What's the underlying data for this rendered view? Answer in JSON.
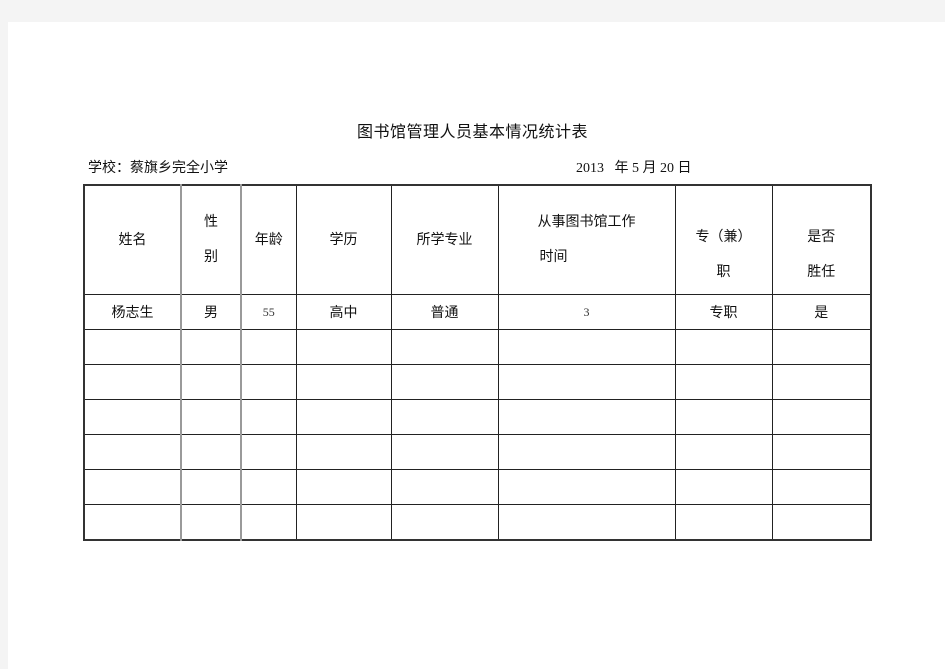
{
  "document": {
    "title": "图书馆管理人员基本情况统计表",
    "school_label": "学校：蔡旗乡完全小学",
    "date": {
      "year": "2013",
      "year_unit": "年",
      "month": "5",
      "month_unit": "月",
      "day": "20",
      "day_unit": "日"
    }
  },
  "table": {
    "headers": [
      {
        "lines": [
          "姓名"
        ]
      },
      {
        "lines": [
          "性",
          "别"
        ]
      },
      {
        "lines": [
          "年龄"
        ]
      },
      {
        "lines": [
          "学历"
        ]
      },
      {
        "lines": [
          "所学专业"
        ]
      },
      {
        "lines": [
          "从事图书馆工作",
          "时间"
        ]
      },
      {
        "lines": [
          "专（兼）",
          "职"
        ]
      },
      {
        "lines": [
          "是否",
          "胜任"
        ]
      }
    ],
    "rows": [
      [
        "杨志生",
        "男",
        "55",
        "高中",
        "普通",
        "3",
        "专职",
        "是"
      ],
      [
        "",
        "",
        "",
        "",
        "",
        "",
        "",
        ""
      ],
      [
        "",
        "",
        "",
        "",
        "",
        "",
        "",
        ""
      ],
      [
        "",
        "",
        "",
        "",
        "",
        "",
        "",
        ""
      ],
      [
        "",
        "",
        "",
        "",
        "",
        "",
        "",
        ""
      ],
      [
        "",
        "",
        "",
        "",
        "",
        "",
        "",
        ""
      ],
      [
        "",
        "",
        "",
        "",
        "",
        "",
        "",
        ""
      ]
    ]
  }
}
